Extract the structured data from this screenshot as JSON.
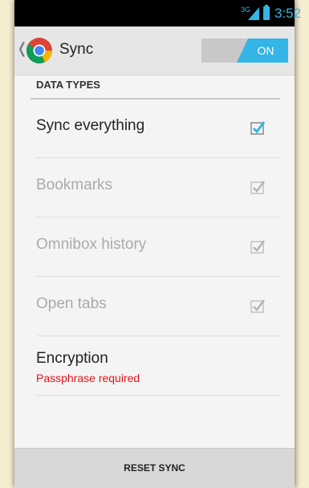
{
  "status_bar": {
    "network": "3G",
    "time": "3:52"
  },
  "action_bar": {
    "title": "Sync",
    "toggle_label": "ON",
    "toggle_state": "on"
  },
  "section": {
    "title": "DATA TYPES"
  },
  "items": [
    {
      "label": "Sync everything",
      "checked": true,
      "enabled": true
    },
    {
      "label": "Bookmarks",
      "checked": true,
      "enabled": false
    },
    {
      "label": "Omnibox history",
      "checked": true,
      "enabled": false
    },
    {
      "label": "Open tabs",
      "checked": true,
      "enabled": false
    }
  ],
  "encryption": {
    "label": "Encryption",
    "status": "Passphrase required"
  },
  "footer": {
    "button_label": "RESET SYNC"
  },
  "colors": {
    "accent": "#33b5e5",
    "warning": "#e0151c"
  }
}
